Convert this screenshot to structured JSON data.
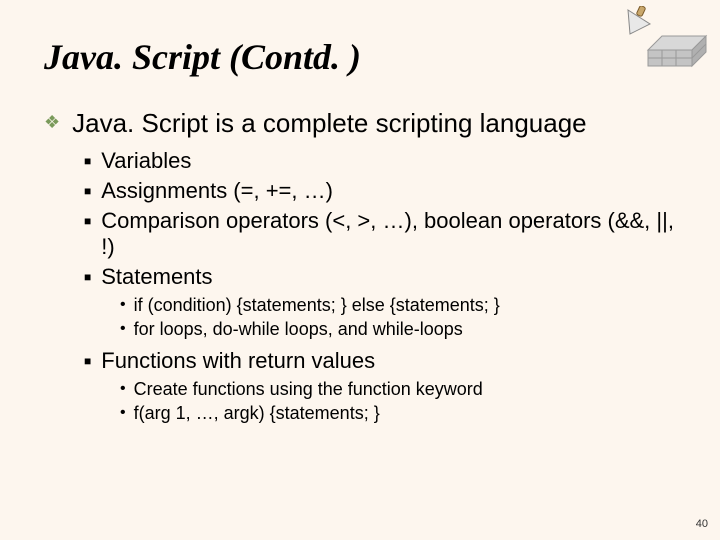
{
  "title": "Java. Script (Contd. )",
  "main_point": "Java. Script is a complete scripting language",
  "sub_points": [
    "Variables",
    "Assignments (=, +=, …)",
    "Comparison operators (<, >, …), boolean operators (&&, ||, !)",
    "Statements"
  ],
  "statements_details": [
    "if (condition) {statements; } else {statements; }",
    "for loops, do-while loops, and while-loops"
  ],
  "functions_point": "Functions with return values",
  "functions_details": [
    "Create functions using the function keyword",
    "f(arg 1, …, argk) {statements; }"
  ],
  "page_number": "40"
}
